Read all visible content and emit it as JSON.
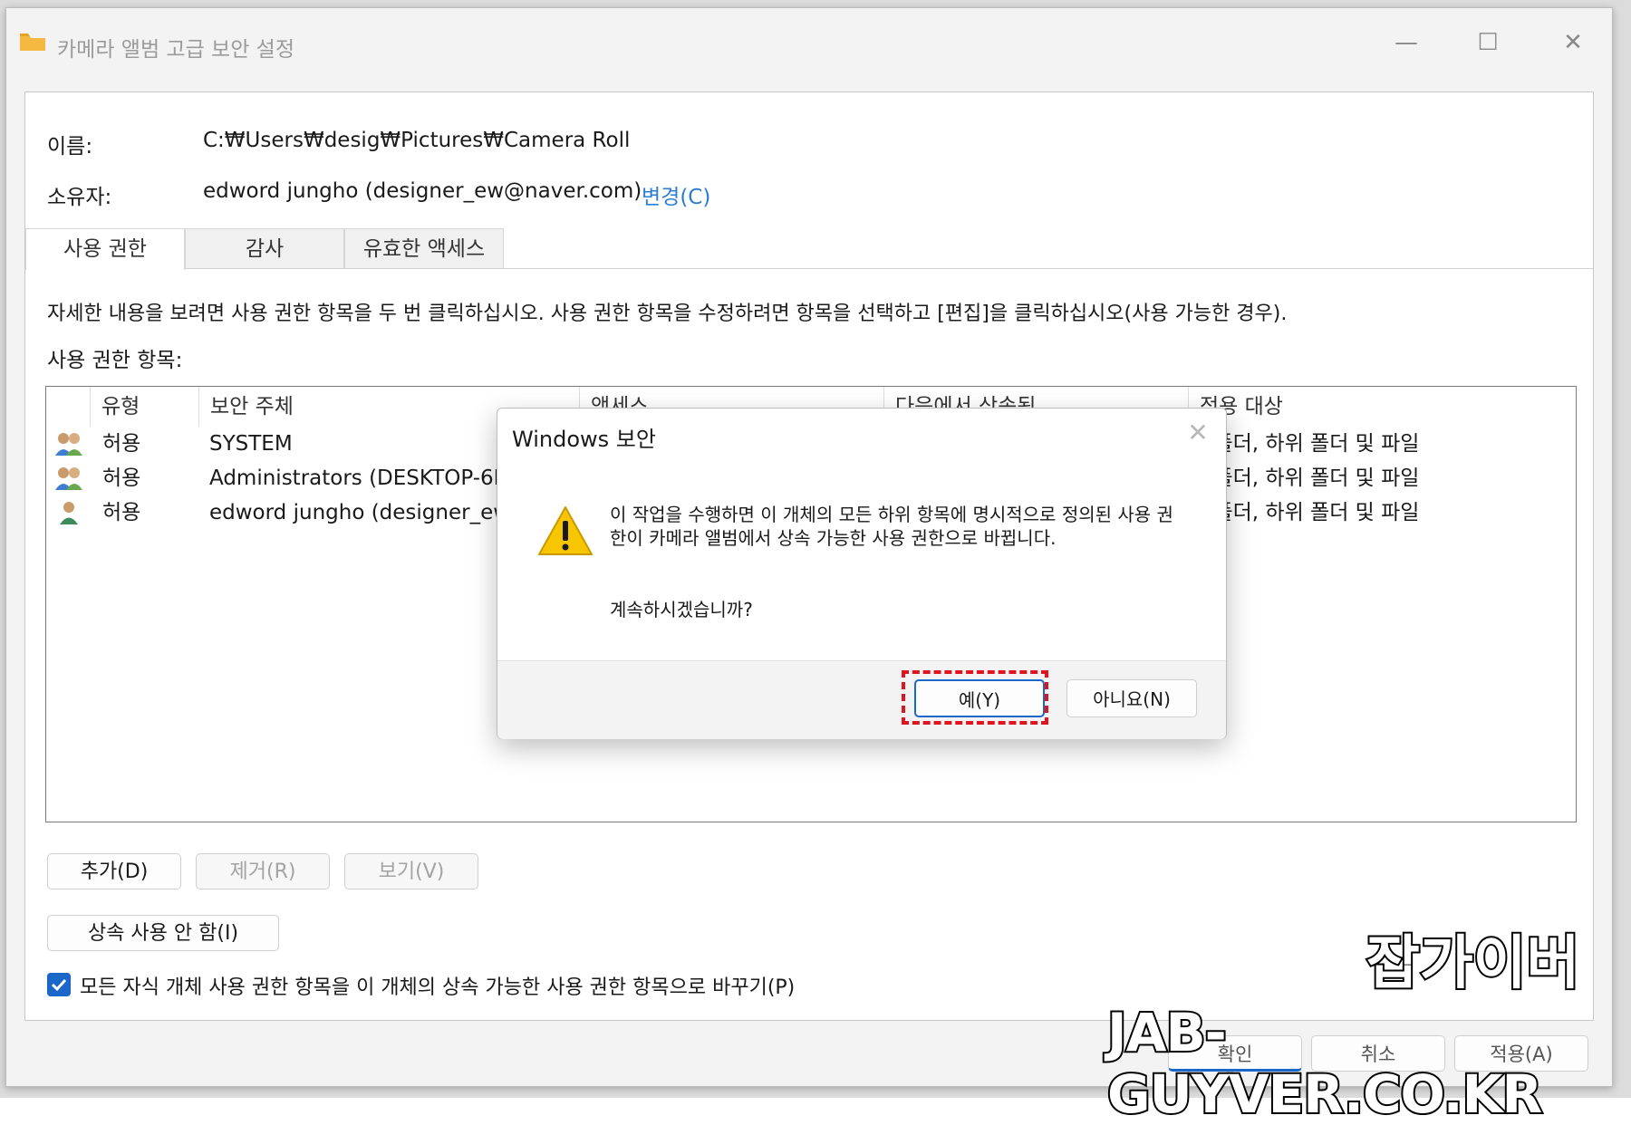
{
  "window": {
    "title": "카메라 앨범 고급 보안 설정",
    "minimize_glyph": "—",
    "maximize_glyph": "☐",
    "close_glyph": "✕",
    "icon": "folder-icon",
    "icon_color": "#f5b942"
  },
  "info": {
    "name_label": "이름:",
    "name_value": "C:₩Users₩desig₩Pictures₩Camera Roll",
    "owner_label": "소유자:",
    "owner_value": "edword jungho (designer_ew@naver.com)",
    "change_link": "변경(C)"
  },
  "tabs": [
    {
      "label": "사용 권한",
      "active": true
    },
    {
      "label": "감사",
      "active": false
    },
    {
      "label": "유효한 액세스",
      "active": false
    }
  ],
  "description": "자세한 내용을 보려면 사용 권한 항목을 두 번 클릭하십시오. 사용 권한 항목을 수정하려면 항목을 선택하고 [편집]을 클릭하십시오(사용 가능한 경우).",
  "permissions": {
    "list_label": "사용 권한 항목:",
    "columns": [
      "유형",
      "보안 주체",
      "액세스",
      "다음에서 상속됨",
      "적용 대상"
    ],
    "rows": [
      {
        "icon": "group-users-icon",
        "type": "허용",
        "principal": "SYSTEM",
        "apply": "이 폴더, 하위 폴더 및 파일"
      },
      {
        "icon": "group-users-icon",
        "type": "허용",
        "principal": "Administrators (DESKTOP-6FB",
        "apply": "이 폴더, 하위 폴더 및 파일"
      },
      {
        "icon": "user-icon",
        "type": "허용",
        "principal": "edword jungho (designer_ew@",
        "apply": "이 폴더, 하위 폴더 및 파일"
      }
    ]
  },
  "buttons": {
    "add": "추가(D)",
    "remove": "제거(R)",
    "view": "보기(V)",
    "disable_inheritance": "상속 사용 안 함(I)"
  },
  "replace_checkbox": {
    "checked": true,
    "label": "모든 자식 개체 사용 권한 항목을 이 개체의 상속 가능한 사용 권한 항목으로 바꾸기(P)"
  },
  "footer": {
    "ok": "확인",
    "cancel": "취소",
    "apply": "적용(A)"
  },
  "dialog": {
    "title": "Windows 보안",
    "close_glyph": "✕",
    "icon": "warning-icon",
    "message": "이 작업을 수행하면 이 개체의 모든 하위 항목에 명시적으로 정의된 사용 권한이 카메라 앨범에서 상속 가능한 사용 권한으로 바뀝니다.",
    "question": "계속하시겠습니까?",
    "yes": "예(Y)",
    "no": "아니요(N)",
    "highlight_color": "#e0141e"
  },
  "watermark": {
    "korean": "잡가이버",
    "english": "JAB-GUYVER.CO.KR"
  },
  "colors": {
    "accent": "#1a66c9",
    "link": "#2b7cd3",
    "warning_yellow": "#f7c600"
  }
}
